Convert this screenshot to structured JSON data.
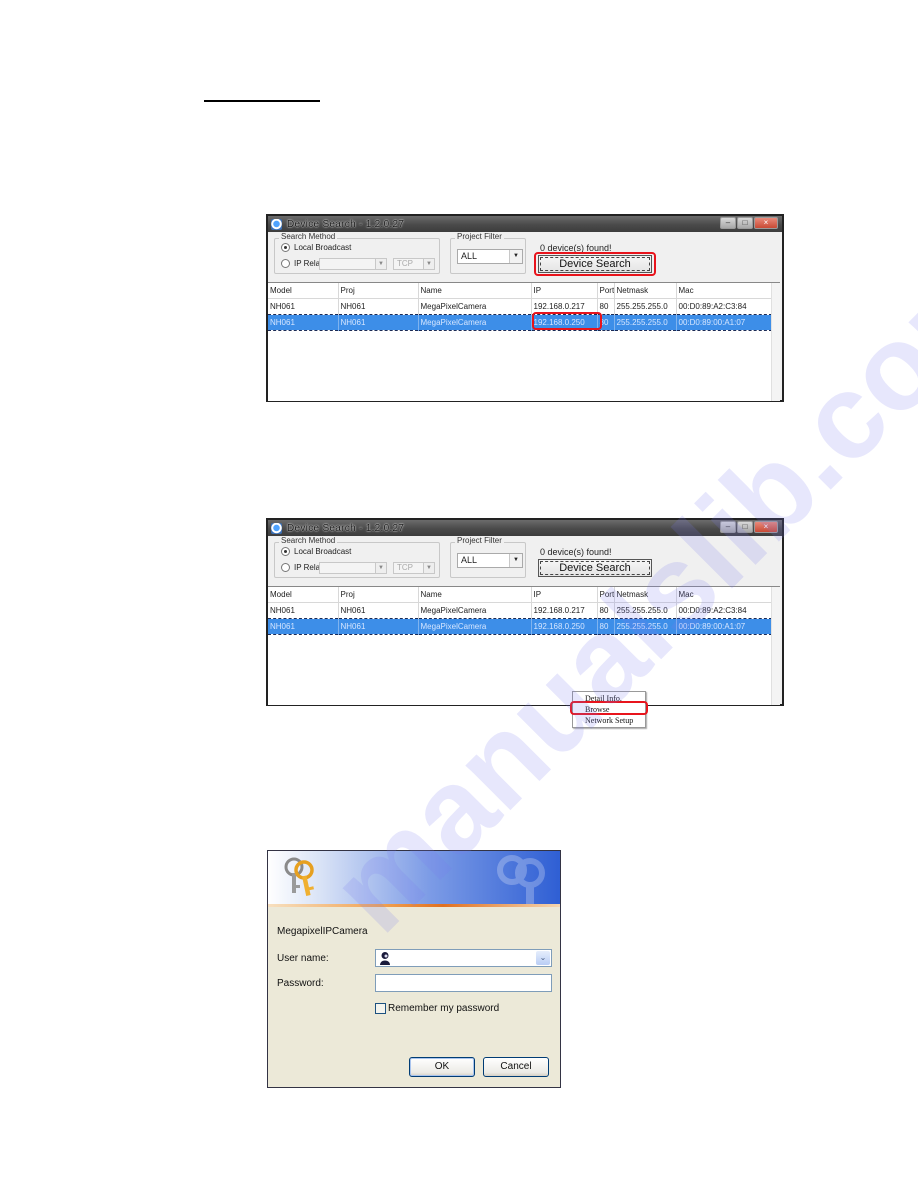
{
  "page": {
    "watermark": "manualslib.com"
  },
  "device_search_windows": [
    {
      "title": "Device Search - 1.2.0.27",
      "search_method": {
        "legend": "Search Method",
        "local_broadcast_label": "Local Broadcast",
        "local_broadcast_selected": true,
        "ip_relay_label": "IP Relay",
        "ip_relay_value": "",
        "protocol_value": "TCP"
      },
      "project_filter": {
        "legend": "Project Filter",
        "value": "ALL"
      },
      "found_text": "0 device(s) found!",
      "search_button_label": "Device Search",
      "columns": [
        "Model",
        "Proj",
        "Name",
        "IP",
        "Port",
        "Netmask",
        "Mac"
      ],
      "rows": [
        [
          "NH061",
          "NH061",
          "MegaPixelCamera",
          "192.168.0.217",
          "80",
          "255.255.255.0",
          "00:D0:89:A2:C3:84"
        ],
        [
          "NH061",
          "NH061",
          "MegaPixelCamera",
          "192.168.0.250",
          "80",
          "255.255.255.0",
          "00:D0:89:00:A1:07"
        ]
      ],
      "selected_row": 1,
      "highlight": [
        "search_button",
        "selected_ip"
      ]
    },
    {
      "title": "Device Search - 1.2.0.27",
      "search_method": {
        "legend": "Search Method",
        "local_broadcast_label": "Local Broadcast",
        "local_broadcast_selected": true,
        "ip_relay_label": "IP Relay",
        "ip_relay_value": "",
        "protocol_value": "TCP"
      },
      "project_filter": {
        "legend": "Project Filter",
        "value": "ALL"
      },
      "found_text": "0 device(s) found!",
      "search_button_label": "Device Search",
      "columns": [
        "Model",
        "Proj",
        "Name",
        "IP",
        "Port",
        "Netmask",
        "Mac"
      ],
      "rows": [
        [
          "NH061",
          "NH061",
          "MegaPixelCamera",
          "192.168.0.217",
          "80",
          "255.255.255.0",
          "00:D0:89:A2:C3:84"
        ],
        [
          "NH061",
          "NH061",
          "MegaPixelCamera",
          "192.168.0.250",
          "80",
          "255.255.255.0",
          "00:D0:89:00:A1:07"
        ]
      ],
      "selected_row": 1,
      "context_menu": {
        "items": [
          "Detail Info.",
          "Browse",
          "Network Setup"
        ],
        "highlighted": "Browse"
      }
    }
  ],
  "login_dialog": {
    "realm": "MegapixelIPCamera",
    "username_label": "User name:",
    "username_value": "",
    "password_label": "Password:",
    "password_value": "",
    "remember_label": "Remember my password",
    "remember_checked": false,
    "ok_label": "OK",
    "cancel_label": "Cancel"
  },
  "colors": {
    "highlight_red": "#e8141c",
    "selection_blue": "#3d8ee8",
    "xp_dialog_bg": "#ece9d8"
  }
}
